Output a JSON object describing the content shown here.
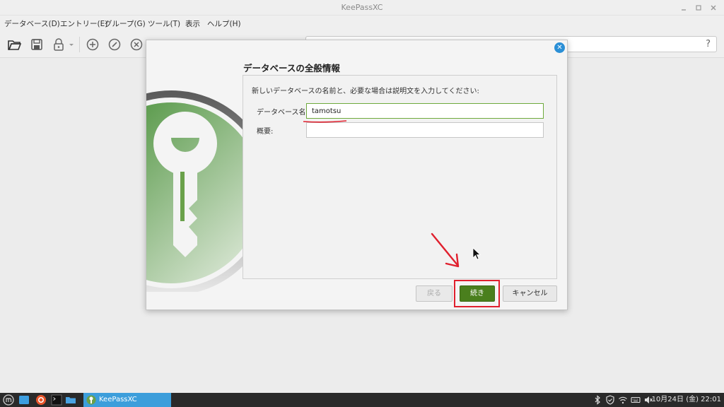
{
  "window": {
    "title": "KeePassXC"
  },
  "menu": [
    "データベース(D)",
    "エントリー(E)",
    "グループ(G)",
    "ツール(T)",
    "表示",
    "ヘルプ(H)"
  ],
  "toolbar": {
    "search_help": "?"
  },
  "dialog": {
    "heading": "データベースの全般情報",
    "intro": "新しいデータベースの名前と、必要な場合は説明文を入力してください:",
    "name_label": "データベース名:",
    "name_value": "tamotsu",
    "desc_label": "概要:",
    "desc_value": "",
    "back_label": "戻る",
    "continue_label": "続き",
    "cancel_label": "キャンセル"
  },
  "taskbar": {
    "app_label": "KeePassXC",
    "clock": "10月24日 (金) 22:01"
  },
  "colors": {
    "accent_green": "#4a7f1d",
    "highlight_red": "#e0202e",
    "close_blue": "#2a8fd6",
    "taskbar_active": "#3c9edb"
  },
  "icons": [
    "open-folder-icon",
    "save-icon",
    "lock-icon",
    "add-entry-icon",
    "edit-entry-icon",
    "delete-entry-icon",
    "keepassxc-logo",
    "mint-menu-icon",
    "files-icon",
    "firefox-icon",
    "terminal-icon",
    "folder-icon",
    "bluetooth-icon",
    "shield-icon",
    "wifi-icon",
    "keyboard-icon",
    "volume-icon"
  ]
}
